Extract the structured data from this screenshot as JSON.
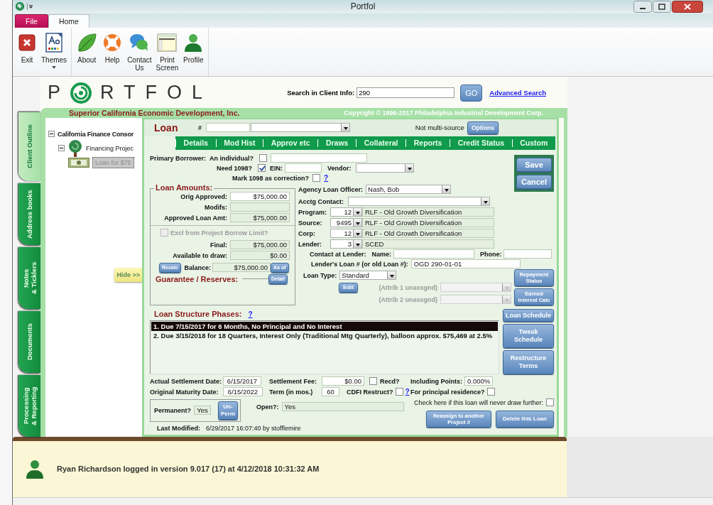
{
  "window": {
    "title": "Portfol"
  },
  "ribbon": {
    "tabs": [
      {
        "label": "File",
        "kind": "menu",
        "selected": false
      },
      {
        "label": "Home",
        "kind": "tab",
        "selected": true
      }
    ],
    "groups": [
      [
        {
          "label": "Exit",
          "kind": "exit",
          "dropdown": false
        },
        {
          "label": "Themes",
          "kind": "themes",
          "dropdown": true
        }
      ],
      [
        {
          "label": "About",
          "kind": "about",
          "dropdown": false
        },
        {
          "label": "Help",
          "kind": "help",
          "dropdown": false
        },
        {
          "label": "Contact\nUs",
          "kind": "contact",
          "dropdown": false
        },
        {
          "label": "Print\nScreen",
          "kind": "print",
          "dropdown": false
        },
        {
          "label": "Profile",
          "kind": "profile",
          "dropdown": false
        }
      ]
    ]
  },
  "header": {
    "logo_left": "P",
    "logo_right": "RTFOL",
    "search_label": "Search in Client Info:",
    "search_value": "290",
    "go": "GO",
    "advanced": "Advanced Search"
  },
  "banner": {
    "organization": "Superior California Economic Development, Inc.",
    "copyright": "Copyright © 1996-2017 Philadelphia Industrial Development Corp."
  },
  "side_tabs": [
    {
      "label": "Client Outline",
      "selected": true
    },
    {
      "label": "Address books",
      "selected": false
    },
    {
      "label": "Notes\n& Ticklers",
      "selected": false
    },
    {
      "label": "Documents",
      "selected": false
    },
    {
      "label": "Processing\n& Reporting",
      "selected": false
    }
  ],
  "tree": [
    {
      "label": "California Finance Consor",
      "kind": "client",
      "expanded": true,
      "selected": false,
      "children": [
        {
          "label": "Financing Projec",
          "kind": "project",
          "expanded": true,
          "selected": false,
          "children": [
            {
              "label": "Loan for $75",
              "kind": "loan",
              "selected": true
            }
          ]
        }
      ]
    }
  ],
  "hide": "Hide >>",
  "loan": {
    "title": "Loan",
    "number_label": "#",
    "multi_source": "Not multi-source",
    "options": "Options",
    "nav": [
      "Details",
      "Mod Hist",
      "Approv etc",
      "Draws",
      "Collateral",
      "Reports",
      "Credit Status",
      "Custom"
    ],
    "save": "Save",
    "cancel": "Cancel",
    "borrower": {
      "label": "Primary Borrower:",
      "individual_label": "An individual?",
      "individual": false
    },
    "need_1098": {
      "label": "Need 1098?",
      "checked": true
    },
    "ein_label": "EIN:",
    "vendor_label": "Vendor:",
    "correction": {
      "label": "Mark 1098 as correction?",
      "checked": false,
      "help": "?"
    },
    "amounts": {
      "title": "Loan Amounts:",
      "rows": [
        {
          "label": "Orig Approved:",
          "value": "$75,000.00",
          "editable": true
        },
        {
          "label": "Modifs:",
          "editable": false
        },
        {
          "label": "Approved Loan Amt:",
          "value": "$75,000.00",
          "editable": false
        }
      ],
      "exclude": {
        "label": "Excl from Project Borrow Limit?",
        "checked": false,
        "disabled": true
      },
      "totals": [
        {
          "label": "Final:",
          "value": "$75,000.00"
        },
        {
          "label": "Available to draw:",
          "value": "$0.00"
        }
      ],
      "recalc": "Recalc",
      "balance_label": "Balance:",
      "balance": "$75,000.00",
      "as_of": "As of"
    },
    "guarantee": {
      "title": "Guarantee / Reserves:",
      "detail": "Detail"
    },
    "officer": {
      "label": "Agency Loan Officer:",
      "value": "Nash, Bob"
    },
    "acctg_label": "Acctg Contact:",
    "codes": [
      {
        "label": "Program:",
        "code": "12",
        "name": "RLF - Old Growth Diversification"
      },
      {
        "label": "Source:",
        "code": "9495",
        "name": "RLF - Old Growth Diversification"
      },
      {
        "label": "Corp:",
        "code": "12",
        "name": "RLF - Old Growth Diversification"
      },
      {
        "label": "Lender:",
        "code": "3",
        "name": "SCED"
      }
    ],
    "contact": {
      "label": "Contact at Lender:",
      "name_label": "Name:",
      "phone_label": "Phone:"
    },
    "lender_loan": {
      "label": "Lender's Loan # (or old Loan #):",
      "value": "OGD 290-01-01"
    },
    "loan_type": {
      "label": "Loan Type:",
      "value": "Standard",
      "edit": "Edit"
    },
    "attributes": [
      {
        "label": "(Attrib 1 unassgnd)",
        "disabled": true
      },
      {
        "label": "(Attrib 2 unassgnd)",
        "disabled": true
      }
    ],
    "side_buttons": [
      "Repayment\nStatus",
      "Earned\nInterest Calc"
    ],
    "phases": {
      "title": "Loan Structure Phases:",
      "help": "?",
      "items": [
        {
          "text": "1.  Due 7/15/2017 for 6 Months, No Principal and No Interest",
          "selected": true
        },
        {
          "text": "2.  Due 3/15/2018 for 18 Quarters, Interest Only (Traditional Mtg Quarterly), balloon approx. $75,469 at 2.5%",
          "selected": false
        }
      ]
    },
    "phase_buttons": [
      "Loan Schedule",
      "Tweak\nSchedule",
      "Restructure\nTerms"
    ],
    "settlement_date": {
      "label": "Actual Settlement Date:",
      "value": "6/15/2017"
    },
    "settlement_fee": {
      "label": "Settlement Fee:",
      "value": "$0.00"
    },
    "received": {
      "label": "Recd?",
      "checked": false
    },
    "points": {
      "label": "Including Points:",
      "value": "0.000%"
    },
    "maturity_date": {
      "label": "Original Maturity Date:",
      "value": "6/15/2022"
    },
    "term": {
      "label": "Term (in mos.)",
      "value": "60"
    },
    "cdfi": {
      "label": "CDFI Restruct?",
      "checked": false,
      "help": "?"
    },
    "residence": {
      "label": "For principal residence?",
      "checked": false
    },
    "no_draw": {
      "label": "Check here if this loan will never draw further:",
      "checked": false
    },
    "permanent": {
      "label": "Permanent?",
      "value": "Yes",
      "button": "Un-\nPerm"
    },
    "open": {
      "label": "Open?:",
      "value": "Yes"
    },
    "reassign": "Reassign to another\nProject #",
    "delete": "Delete this Loan",
    "last_modified": {
      "label": "Last Modified:",
      "value": "6/29/2017 16:07:40 by stofflemire"
    }
  },
  "status": {
    "text": "Ryan Richardson logged in version 9.017 (17) at 4/12/2018 10:31:32 AM"
  }
}
